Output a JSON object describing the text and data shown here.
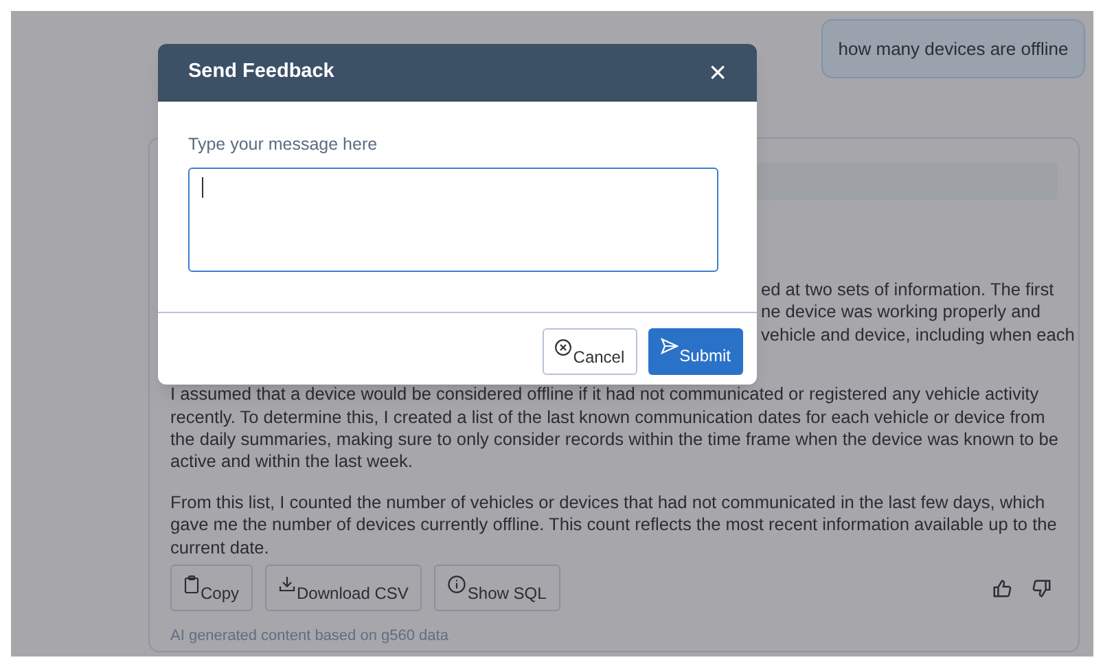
{
  "chat": {
    "user_message": "how many devices are offline",
    "answer": {
      "paragraphs": [
        {
          "lines": [
            "ed at two sets of information. The first",
            "ne device was working properly and",
            "vehicle and device, including when each"
          ]
        },
        {
          "lines": [
            "I assumed that a device would be considered offline if it had not communicated or registered any vehicle activity",
            "recently. To determine this, I created a list of the last known communication dates for each vehicle or device from",
            "the daily summaries, making sure to only consider records within the time frame when the device was known to be",
            "active and within the last week."
          ]
        },
        {
          "lines": [
            "From this list, I counted the number of vehicles or devices that had not communicated in the last few days, which",
            "gave me the number of devices currently offline. This count reflects the most recent information available up to the",
            "current date."
          ]
        }
      ],
      "actions": [
        {
          "label": "Copy",
          "kind": "copy"
        },
        {
          "label": "Download CSV",
          "kind": "download"
        },
        {
          "label": "Show SQL",
          "kind": "info"
        }
      ],
      "footnote": "AI generated content based on g560 data"
    }
  },
  "modal": {
    "title": "Send Feedback",
    "close": "×",
    "label": "Type your message here",
    "buttons": [
      {
        "label": "Cancel",
        "kind": "secondary"
      },
      {
        "label": "Submit",
        "kind": "primary"
      }
    ]
  }
}
